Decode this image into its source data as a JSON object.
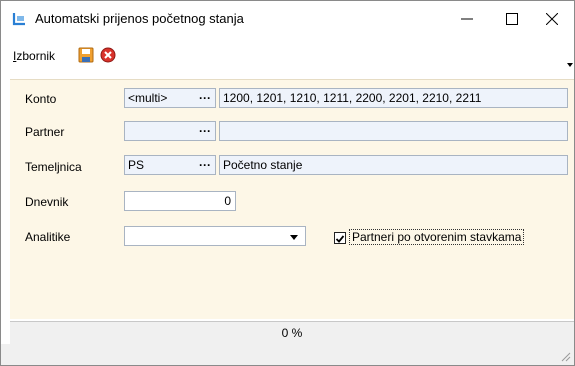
{
  "window": {
    "title": "Automatski prijenos početnog stanja"
  },
  "menubar": {
    "izbornik_first": "I",
    "izbornik_rest": "zbornik"
  },
  "form": {
    "konto": {
      "label": "Konto",
      "code": "<multi>",
      "value": "1200, 1201, 1210, 1211, 2200, 2201, 2210, 2211"
    },
    "partner": {
      "label": "Partner",
      "code": "",
      "value": ""
    },
    "temeljnica": {
      "label": "Temeljnica",
      "code": "PS",
      "value": "Početno stanje"
    },
    "dnevnik": {
      "label": "Dnevnik",
      "value": "0"
    },
    "analitike": {
      "label": "Analitike",
      "value": ""
    },
    "partneri_checkbox": {
      "label": "Partneri po otvorenim stavkama",
      "checked": true
    }
  },
  "status": {
    "progress_text": "0 %",
    "progress": 0
  },
  "colors": {
    "content_bg": "#fdf7e7",
    "field_bg": "#eef3fb",
    "cancel_red": "#d9322b",
    "save_orange": "#f0a030"
  }
}
